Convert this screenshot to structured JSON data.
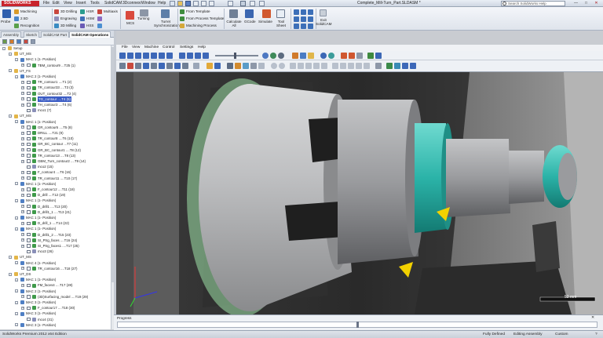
{
  "app": {
    "logo_text": "SOLIDWORKS",
    "document_title": "Complete_Mill-Turn_Part.SLDASM *",
    "menus": [
      "File",
      "Edit",
      "View",
      "Insert",
      "Tools",
      "SolidCAM",
      "3Dconnexi",
      "Window",
      "Help"
    ],
    "help_search_placeholder": "Search SolidWorks Help"
  },
  "ribbon": {
    "left_group": {
      "probe": "Probe",
      "machining": "Machining",
      "value_2_5d": "2.5D",
      "recognition": "Recognition"
    },
    "drill_group": {
      "drilling_3d": "3D Drilling",
      "engraving": "Engraving",
      "milling_3d": "3D Milling"
    },
    "hsr_group": {
      "hsr": "HSR",
      "hsm": "HSM",
      "hss": "HSS"
    },
    "multiaxis": "Multiaxis",
    "turning": "Turning",
    "mcs": "MCS",
    "turret_sync": "Turret\nSynchronization",
    "templates": {
      "from_template": "From Template",
      "from_process_template": "From Process Template",
      "machining_process": "Machining Process"
    },
    "calculate_all": "Calculate\nAll",
    "gcode": "GCode",
    "simulate": "Simulate",
    "tool_sheet": "Tool\nSheet",
    "exit": "Exit\nSolidCAM"
  },
  "tabs": [
    "Assembly",
    "Sketch",
    "SolidCAM Part",
    "SolidCAM Operations"
  ],
  "tree": [
    {
      "label": "Setup",
      "indent": 1,
      "exp": "-",
      "chk": false,
      "icon": "folder"
    },
    {
      "label": "UT_MS",
      "indent": 2,
      "exp": "-",
      "chk": false,
      "icon": "folder"
    },
    {
      "label": "MAC 1 (1- Position)",
      "indent": 3,
      "exp": "-",
      "chk": false,
      "icon": "mac"
    },
    {
      "label": "TBM_contour9 ...T25 (1)",
      "indent": 4,
      "exp": "+",
      "chk": true,
      "icon": "op"
    },
    {
      "label": "UT_FS",
      "indent": 2,
      "exp": "-",
      "chk": false,
      "icon": "folder"
    },
    {
      "label": "MAC 2 (1- Position)",
      "indent": 3,
      "exp": "-",
      "chk": false,
      "icon": "mac"
    },
    {
      "label": "TR_contour1 ....T1 (2)",
      "indent": 4,
      "exp": "+",
      "chk": true,
      "icon": "op"
    },
    {
      "label": "TR_contour33 ....T3 (3)",
      "indent": 4,
      "exp": "+",
      "chk": true,
      "icon": "op"
    },
    {
      "label": "OUT_contour32 ....T2 (4)",
      "indent": 4,
      "exp": "+",
      "chk": true,
      "icon": "op"
    },
    {
      "label": "TG_contour ....T4 (5)",
      "indent": 4,
      "exp": "+",
      "chk": true,
      "icon": "op",
      "sel": true
    },
    {
      "label": "TH_contour3 ....T4 (6)",
      "indent": 4,
      "exp": "+",
      "chk": true,
      "icon": "op"
    },
    {
      "label": "mco1 (7)",
      "indent": 4,
      "exp": "",
      "chk": true,
      "icon": "mco"
    },
    {
      "label": "UT_MS",
      "indent": 2,
      "exp": "-",
      "chk": false,
      "icon": "folder"
    },
    {
      "label": "MAC 1 (1- Position)",
      "indent": 3,
      "exp": "-",
      "chk": false,
      "icon": "mac"
    },
    {
      "label": "GR_contour6 ....T5 (8)",
      "indent": 4,
      "exp": "+",
      "chk": true,
      "icon": "op"
    },
    {
      "label": "DRILL ....T21 (9)",
      "indent": 4,
      "exp": "+",
      "chk": true,
      "icon": "op"
    },
    {
      "label": "TR_contour8 ....T6 (10)",
      "indent": 4,
      "exp": "+",
      "chk": true,
      "icon": "op"
    },
    {
      "label": "GR_BC_contour ...T7 (11)",
      "indent": 4,
      "exp": "+",
      "chk": true,
      "icon": "op"
    },
    {
      "label": "GR_BC_contour1 ....T8 (12)",
      "indent": 4,
      "exp": "+",
      "chk": true,
      "icon": "op"
    },
    {
      "label": "TR_contour13 ....T8 (13)",
      "indent": 4,
      "exp": "+",
      "chk": true,
      "icon": "op"
    },
    {
      "label": "GBM_Turn_contour2 ....T9 (14)",
      "indent": 4,
      "exp": "+",
      "chk": true,
      "icon": "op"
    },
    {
      "label": "mco2 (15)",
      "indent": 4,
      "exp": "",
      "chk": true,
      "icon": "mco"
    },
    {
      "label": "F_contour4 ....T6 (16)",
      "indent": 4,
      "exp": "+",
      "chk": true,
      "icon": "op"
    },
    {
      "label": "TR_contour11 ....T10 (17)",
      "indent": 4,
      "exp": "+",
      "chk": true,
      "icon": "op"
    },
    {
      "label": "MAC 1 (1- Position)",
      "indent": 3,
      "exp": "-",
      "chk": false,
      "icon": "mac"
    },
    {
      "label": "F_contour12 ....T11 (18)",
      "indent": 4,
      "exp": "+",
      "chk": true,
      "icon": "op"
    },
    {
      "label": "D_drill ....T12 (19)",
      "indent": 4,
      "exp": "+",
      "chk": true,
      "icon": "op"
    },
    {
      "label": "MAC 1 (1- Position)",
      "indent": 3,
      "exp": "-",
      "chk": false,
      "icon": "mac"
    },
    {
      "label": "D_drill1 ....T13 (20)",
      "indent": 4,
      "exp": "+",
      "chk": true,
      "icon": "op"
    },
    {
      "label": "D_drill1_1 ....T13 (21)",
      "indent": 4,
      "exp": "+",
      "chk": true,
      "icon": "op"
    },
    {
      "label": "MAC 1 (1- Position)",
      "indent": 3,
      "exp": "-",
      "chk": false,
      "icon": "mac"
    },
    {
      "label": "D_drill_1 ....T14 (22)",
      "indent": 4,
      "exp": "+",
      "chk": true,
      "icon": "op"
    },
    {
      "label": "MAC 1 (1- Position)",
      "indent": 3,
      "exp": "-",
      "chk": false,
      "icon": "mac"
    },
    {
      "label": "D_drill1_2 ....T15 (23)",
      "indent": 4,
      "exp": "+",
      "chk": true,
      "icon": "op"
    },
    {
      "label": "SI_Ptrg_faces ....T16 (24)",
      "indent": 4,
      "exp": "+",
      "chk": true,
      "icon": "op"
    },
    {
      "label": "SI_Ptrg_faces1 ....T17 (25)",
      "indent": 4,
      "exp": "+",
      "chk": true,
      "icon": "op"
    },
    {
      "label": "mco3 (26)",
      "indent": 4,
      "exp": "",
      "chk": true,
      "icon": "mco"
    },
    {
      "label": "UT_MS",
      "indent": 2,
      "exp": "-",
      "chk": false,
      "icon": "folder"
    },
    {
      "label": "MAC 4 (1- Position)",
      "indent": 3,
      "exp": "-",
      "chk": false,
      "icon": "mac"
    },
    {
      "label": "TR_contour16 ....T18 (27)",
      "indent": 4,
      "exp": "+",
      "chk": true,
      "icon": "op"
    },
    {
      "label": "UT_DS",
      "indent": 2,
      "exp": "-",
      "chk": false,
      "icon": "folder"
    },
    {
      "label": "MAC 1 (1- Position)",
      "indent": 3,
      "exp": "-",
      "chk": false,
      "icon": "mac"
    },
    {
      "label": "FM_faces4 ....T17 (28)",
      "indent": 4,
      "exp": "+",
      "chk": true,
      "icon": "op"
    },
    {
      "label": "MAC 2 (1- Position)",
      "indent": 3,
      "exp": "-",
      "chk": false,
      "icon": "mac"
    },
    {
      "label": "(3D)Surfacing_model ....T19 (29)",
      "indent": 4,
      "exp": "+",
      "chk": true,
      "icon": "op"
    },
    {
      "label": "MAC 3 (1- Position)",
      "indent": 3,
      "exp": "-",
      "chk": false,
      "icon": "mac"
    },
    {
      "label": "F_contour17 ....T18 (30)",
      "indent": 4,
      "exp": "+",
      "chk": true,
      "icon": "op"
    },
    {
      "label": "MAC 3 (1- Position)",
      "indent": 3,
      "exp": "-",
      "chk": false,
      "icon": "mac"
    },
    {
      "label": "mco4 (31)",
      "indent": 4,
      "exp": "",
      "chk": true,
      "icon": "mco"
    },
    {
      "label": "MAC 3 (1- Position)",
      "indent": 3,
      "exp": "-",
      "chk": false,
      "icon": "mac"
    }
  ],
  "sim": {
    "menus": [
      "File",
      "View",
      "Machine",
      "Control",
      "Settings",
      "Help"
    ],
    "scale_value": "52",
    "scale_unit": "mm"
  },
  "progress": {
    "label": "Progress",
    "value": 0.5
  },
  "status": {
    "left": "SolidWorks Premium 2012 x64 Edition",
    "fully_defined": "Fully Defined",
    "editing": "Editing Assembly",
    "unit": "Custom",
    "help": "?"
  },
  "colors": {
    "accent_teal": "#2bb3a8",
    "part_grey": "#9a9b9e",
    "ribbon_blue": "#2f5fae",
    "selection": "#3b5cc4",
    "brand_red": "#c8232c",
    "tool_yellow": "#f2d100"
  }
}
